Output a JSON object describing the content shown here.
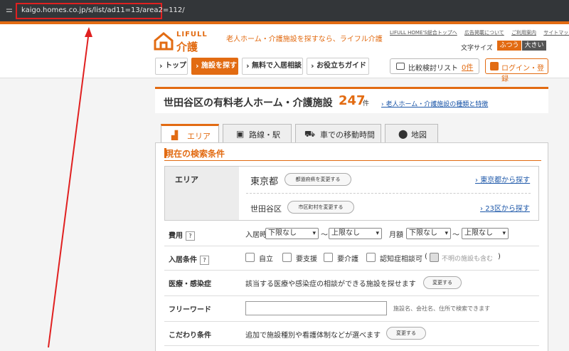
{
  "browser": {
    "url": "kaigo.homes.co.jp/s/list/ad11=13/area2=112/"
  },
  "header": {
    "logo_top": "LIFULL",
    "logo_bottom": "介護",
    "tagline": "老人ホーム・介護施設を探すなら、ライフル介護",
    "toplinks": [
      "LIFULL HOME'S総合トップへ",
      "広告掲載について",
      "ご利用案内",
      "サイトマップ"
    ],
    "font_size_label": "文字サイズ",
    "font_normal": "ふつう",
    "font_large": "大きい",
    "nav": [
      "トップ",
      "施設を探す",
      "無料で入居相談",
      "お役立ちガイド"
    ],
    "compare_label": "比較検討リスト",
    "compare_count": "0件",
    "login_label": "ログイン・登録"
  },
  "result": {
    "title": "世田谷区の有料老人ホーム・介護施設",
    "count": "247",
    "unit": "件",
    "link": "老人ホーム・介護施設の種類と特徴"
  },
  "tabs": [
    {
      "label": "エリア",
      "icon": "area-icon"
    },
    {
      "label": "路線・駅",
      "icon": "train-icon"
    },
    {
      "label": "車での移動時間",
      "icon": "car-icon"
    },
    {
      "label": "地図",
      "icon": "map-pin-icon"
    }
  ],
  "conditions": {
    "title": "現在の検索条件",
    "area_label": "エリア",
    "prefecture": "東京都",
    "pref_change": "都道府県を変更する",
    "pref_link": "東京都から探す",
    "city": "世田谷区",
    "city_change": "市区町村を変更する",
    "city_link": "23区から探す"
  },
  "cost": {
    "label": "費用",
    "help": "?",
    "entry_label": "入居時",
    "entry_min": "下限なし",
    "entry_max": "上限なし",
    "monthly_label": "月額",
    "monthly_min": "下限なし",
    "monthly_max": "上限なし",
    "tilde": "〜"
  },
  "admission": {
    "label": "入居条件",
    "help": "?",
    "options": [
      "自立",
      "要支援",
      "要介護",
      "認知症相談可"
    ],
    "paren_open": "(",
    "unknown": "不明の施設も含む",
    "paren_close": ")"
  },
  "medical": {
    "label": "医療・感染症",
    "text": "該当する医療や感染症の相談ができる施設を探せます",
    "button": "変更する"
  },
  "freeword": {
    "label": "フリーワード",
    "placeholder": "",
    "hint": "施設名、会社名、住所で検索できます"
  },
  "kodawari": {
    "label": "こだわり条件",
    "text": "追加で施設種別や看護体制などが選べます",
    "button": "変更する"
  },
  "colors": {
    "accent": "#e26b12",
    "link": "#1b56a8",
    "annotation": "#e02020"
  }
}
